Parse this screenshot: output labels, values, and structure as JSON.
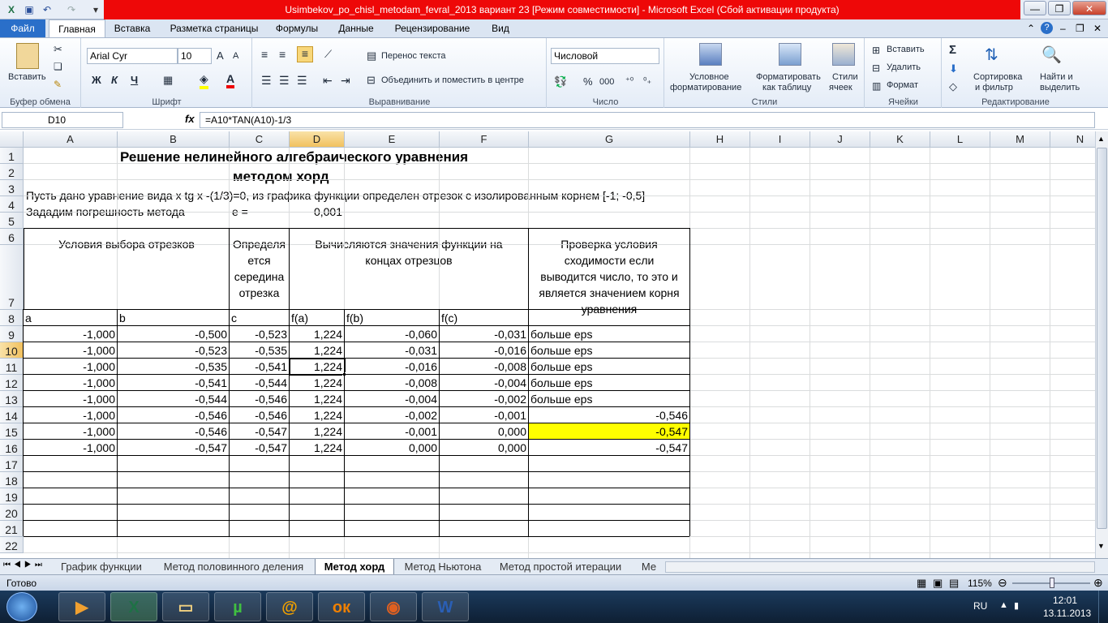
{
  "window": {
    "title": "Usimbekov_po_chisl_metodam_fevral_2013 вариант 23  [Режим совместимости]  -  Microsoft Excel (Сбой активации продукта)"
  },
  "quick_access": {
    "save_icon": "save-icon",
    "undo_icon": "undo-icon",
    "redo_icon": "redo-icon"
  },
  "tabs": [
    "Файл",
    "Главная",
    "Вставка",
    "Разметка страницы",
    "Формулы",
    "Данные",
    "Рецензирование",
    "Вид"
  ],
  "ribbon": {
    "clipboard": {
      "label": "Буфер обмена",
      "paste": "Вставить"
    },
    "font": {
      "label": "Шрифт",
      "font_name": "Arial Cyr",
      "font_size": "10",
      "bold": "Ж",
      "italic": "К",
      "underline": "Ч"
    },
    "alignment": {
      "label": "Выравнивание",
      "wrap": "Перенос текста",
      "merge": "Объединить и поместить в центре"
    },
    "number": {
      "label": "Число",
      "format": "Числовой",
      "percent": "%",
      "thousands": "000"
    },
    "styles": {
      "label": "Стили",
      "cond_format_1": "Условное",
      "cond_format_2": "форматирование",
      "table_format_1": "Форматировать",
      "table_format_2": "как таблицу",
      "cell_styles_1": "Стили",
      "cell_styles_2": "ячеек"
    },
    "cells": {
      "label": "Ячейки",
      "insert": "Вставить",
      "delete": "Удалить",
      "format": "Формат"
    },
    "editing": {
      "label": "Редактирование",
      "sum": "Σ",
      "sort_1": "Сортировка",
      "sort_2": "и фильтр",
      "find_1": "Найти и",
      "find_2": "выделить"
    }
  },
  "formula_bar": {
    "name_box": "D10",
    "fx": "fx",
    "formula": "=A10*TAN(A10)-1/3"
  },
  "columns": [
    "A",
    "B",
    "C",
    "D",
    "E",
    "F",
    "G",
    "H",
    "I",
    "J",
    "K",
    "L",
    "M",
    "N"
  ],
  "rows": [
    "1",
    "2",
    "3",
    "4",
    "5",
    "6",
    "7",
    "8",
    "9",
    "10",
    "11",
    "12",
    "13",
    "14",
    "15",
    "16",
    "17",
    "18",
    "19",
    "20",
    "21",
    "22"
  ],
  "sheet": {
    "title1": "Решение нелинейного алгебраического уравнения",
    "title2": "методом хорд",
    "r3": "Пусть дано уравнение вида x tg x -(1/3)=0, из графика функции определен отрезок с изолированным корнем [-1; -0,5]",
    "r4_label": "Зададим погрешность метода",
    "r4_e": "e =",
    "r4_val": "0,001",
    "h_ab": "Условия выбора отрезков",
    "h_c_1": "Определя",
    "h_c_2": "ется",
    "h_c_3": "середина",
    "h_c_4": "отрезка",
    "h_f_1": "Вычисляются значения функции на",
    "h_f_2": "концах отрезцов",
    "h_g_1": "Проверка условия",
    "h_g_2": "сходимости если",
    "h_g_3": "выводится число, то это и",
    "h_g_4": "является значением корня",
    "h_g_5": "уравнения",
    "r8": [
      "a",
      "b",
      "c",
      "f(a)",
      "f(b)",
      "f(c)"
    ],
    "data": [
      [
        "-1,000",
        "-0,500",
        "-0,523",
        "1,224",
        "-0,060",
        "-0,031",
        "больше eps"
      ],
      [
        "-1,000",
        "-0,523",
        "-0,535",
        "1,224",
        "-0,031",
        "-0,016",
        "больше eps"
      ],
      [
        "-1,000",
        "-0,535",
        "-0,541",
        "1,224",
        "-0,016",
        "-0,008",
        "больше eps"
      ],
      [
        "-1,000",
        "-0,541",
        "-0,544",
        "1,224",
        "-0,008",
        "-0,004",
        "больше eps"
      ],
      [
        "-1,000",
        "-0,544",
        "-0,546",
        "1,224",
        "-0,004",
        "-0,002",
        "больше eps"
      ],
      [
        "-1,000",
        "-0,546",
        "-0,546",
        "1,224",
        "-0,002",
        "-0,001",
        "-0,546"
      ],
      [
        "-1,000",
        "-0,546",
        "-0,547",
        "1,224",
        "-0,001",
        "0,000",
        "-0,547"
      ],
      [
        "-1,000",
        "-0,547",
        "-0,547",
        "1,224",
        "0,000",
        "0,000",
        "-0,547"
      ]
    ],
    "highlight_color": "#ffff00"
  },
  "sheet_tabs": [
    "График функции",
    "Метод половинного деления",
    "Метод хорд",
    "Метод Ньютона",
    "Метод простой итерации",
    "Ме"
  ],
  "active_sheet": "Метод хорд",
  "status": {
    "ready": "Готово",
    "zoom": "115%"
  },
  "taskbar": {
    "lang": "RU",
    "time": "12:01",
    "date": "13.11.2013"
  }
}
